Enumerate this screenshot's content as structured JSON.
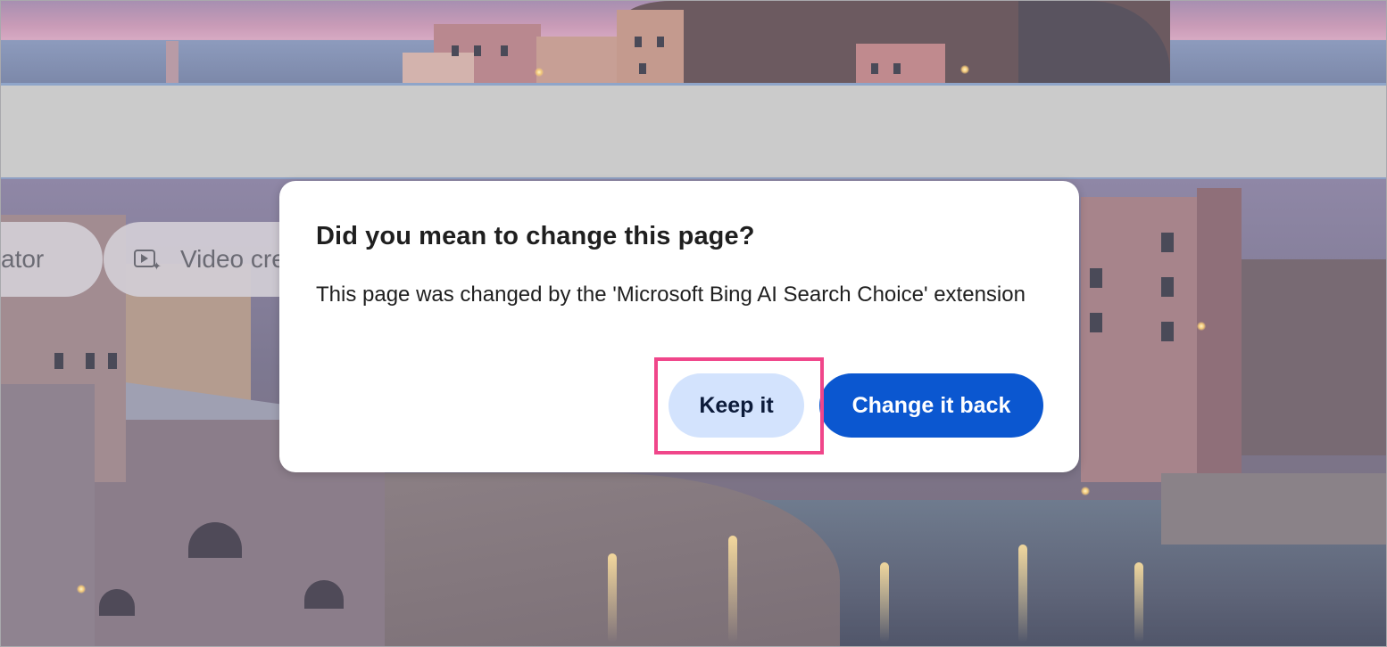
{
  "background": {
    "pills": {
      "creator_label": "ator",
      "video_label": "Video cre",
      "video_icon": "video-sparkle-icon"
    }
  },
  "dialog": {
    "title": "Did you mean to change this page?",
    "body": "This page was changed by the 'Microsoft Bing AI Search Choice' extension",
    "keep_button": "Keep it",
    "change_back_button": "Change it back"
  },
  "colors": {
    "primary_button": "#0b57d0",
    "secondary_button": "#d3e3fd",
    "highlight": "#f0468a"
  }
}
